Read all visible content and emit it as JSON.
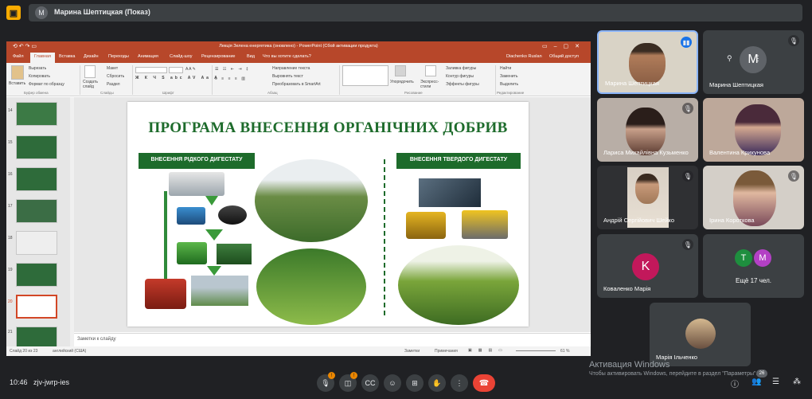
{
  "presenter_chip": {
    "avatar": "M",
    "name": "Марина Шептицкая (Показ)"
  },
  "meet_logo": {
    "icon": "presentation-icon",
    "color": "#f9ab00"
  },
  "ppt": {
    "window_title": "Лекція Зелена енергетика (оновлено) - PowerPoint (Сбой активации продукта)",
    "user": "Diachenko Ruslan",
    "share": "Общий доступ",
    "tabs": [
      "Файл",
      "Главная",
      "Вставка",
      "Дизайн",
      "Переходы",
      "Анимация",
      "Слайд-шоу",
      "Рецензирование",
      "Вид",
      "Что вы хотите сделать?"
    ],
    "ribbon": {
      "paste": "Вставить",
      "cut": "Вырезать",
      "copy": "Копировать",
      "format_painter": "Формат по образцу",
      "clipboard_group": "Буфер обмена",
      "new_slide": "Создать слайд",
      "layout": "Макет",
      "reset": "Сбросить",
      "section": "Раздел",
      "slides_group": "Слайды",
      "font_group": "Шрифт",
      "text_direction": "Направление текста",
      "align_text": "Выровнять текст",
      "smartart": "Преобразовать в SmartArt",
      "paragraph_group": "Абзац",
      "arrange": "Упорядочить",
      "quick_styles": "Экспресс-стили",
      "shape_fill": "Заливка фигуры",
      "shape_outline": "Контур фигуры",
      "shape_effects": "Эффекты фигуры",
      "drawing_group": "Рисование",
      "find": "Найти",
      "replace": "Заменить",
      "select": "Выделить",
      "editing_group": "Редактирование"
    },
    "thumbnails": [
      {
        "num": "14",
        "color": "#3c7a45"
      },
      {
        "num": "15",
        "color": "#2e6b3a"
      },
      {
        "num": "16",
        "color": "#2e6b3a"
      },
      {
        "num": "17",
        "color": "#3b6d45"
      },
      {
        "num": "18",
        "color": "#eeeeee"
      },
      {
        "num": "19",
        "color": "#2e6b3a"
      },
      {
        "num": "20",
        "color": "#ffffff"
      },
      {
        "num": "21",
        "color": "#2e6b3a"
      }
    ],
    "slide": {
      "title": "ПРОГРАМА ВНЕСЕННЯ ОРГАНІЧНИХ ДОБРИВ",
      "label_left": "ВНЕСЕННЯ РІДКОГО ДИГЕСТАТУ",
      "label_right": "ВНЕСЕННЯ ТВЕРДОГО ДИГЕСТАТУ",
      "accent_color": "#1d6b2b"
    },
    "notes": "Заметки к слайду",
    "status": {
      "slide_info": "Слайд 20 из 23",
      "language": "английский (США)",
      "notes_btn": "Заметки",
      "comments_btn": "Примечания",
      "zoom": "61 %"
    }
  },
  "participants": [
    {
      "name": "Марина Шептицкая",
      "type": "video",
      "speaking": true
    },
    {
      "name": "Марина Шептицкая",
      "type": "avatar",
      "initial": "M",
      "muted": true
    },
    {
      "name": "Лариса Михайлівна Кузьменко",
      "type": "video",
      "muted": true
    },
    {
      "name": "Валентина Крикунова",
      "type": "video"
    },
    {
      "name": "Андрій Сергійович Шейко",
      "type": "video",
      "muted": true
    },
    {
      "name": "Ірина Короткова",
      "type": "video",
      "muted": true
    },
    {
      "name": "Коваленко Марія",
      "type": "avatar",
      "initial": "K",
      "color": "#c2185b",
      "muted": true
    },
    {
      "name": "Ещё 17 чел.",
      "type": "more",
      "initials": [
        "T",
        "M"
      ]
    },
    {
      "name": "Марія Ільченко",
      "type": "video"
    }
  ],
  "bottom": {
    "clock": "10:46",
    "meeting_code": "zjv-jwrp-ies",
    "mic_badge": "!",
    "cam_badge": "!",
    "people_count": "26"
  },
  "watermark": {
    "line1": "Активация Windows",
    "line2": "Чтобы активировать Windows, перейдите в раздел \"Параметры\"."
  }
}
